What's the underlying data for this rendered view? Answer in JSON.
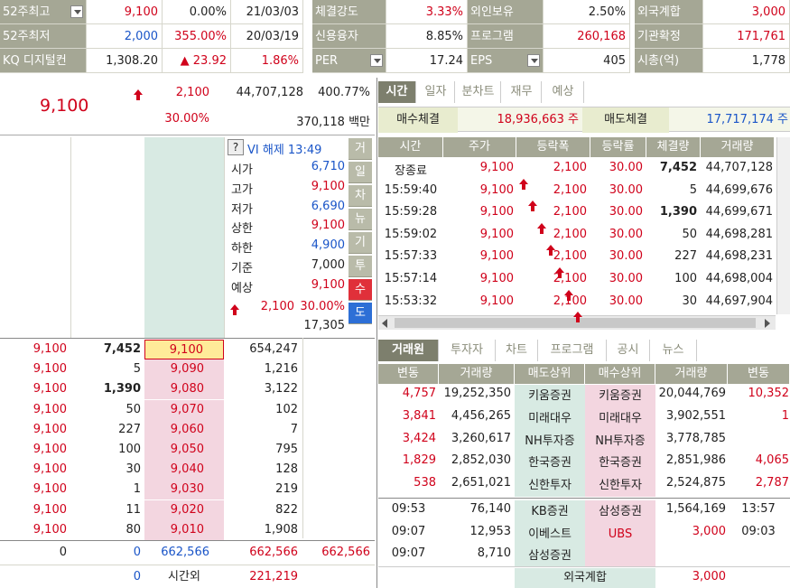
{
  "top": {
    "r1": {
      "l1": "52주최고",
      "v1": "9,100",
      "p1": "0.00%",
      "d1": "21/03/03",
      "l2": "체결강도",
      "v2": "3.33%",
      "l3": "외인보유",
      "v3": "2.50%",
      "l4": "외국계합",
      "v4": "3,000"
    },
    "r2": {
      "l1": "52주최저",
      "v1": "2,000",
      "p1": "355.00%",
      "d1": "20/03/19",
      "l2": "신용융자",
      "v2": "8.85%",
      "l3": "프로그램",
      "v3": "260,168",
      "l4": "기관확정",
      "v4": "171,761"
    },
    "r3": {
      "l1": "KQ 디지털컨",
      "v1": "1,308.20",
      "p1": "▲ 23.92",
      "d1": "1.86%",
      "l2": "PER",
      "v2": "17.24",
      "l3": "EPS",
      "v3": "405",
      "l4": "시총(억)",
      "v4": "1,778"
    }
  },
  "price": {
    "current": "9,100",
    "change": "2,100",
    "volume": "44,707,128",
    "vol_rate": "400.77%",
    "change_rate": "30.00%",
    "amount": "370,118 백만"
  },
  "vi": {
    "q": "?",
    "text": "VI 해제 13:49"
  },
  "info": [
    {
      "label": "시가",
      "value": "6,710",
      "color": "blue"
    },
    {
      "label": "고가",
      "value": "9,100",
      "color": "red"
    },
    {
      "label": "저가",
      "value": "6,690",
      "color": "blue"
    },
    {
      "label": "상한",
      "value": "9,100",
      "color": "red"
    },
    {
      "label": "하한",
      "value": "4,900",
      "color": "blue"
    },
    {
      "label": "기준",
      "value": "7,000",
      "color": "black"
    },
    {
      "label": "예상",
      "value": "9,100",
      "color": "red"
    }
  ],
  "expected": {
    "change": "2,100",
    "rate": "30.00%",
    "qty": "17,305"
  },
  "side_buttons": [
    "거",
    "일",
    "차",
    "뉴",
    "기",
    "투",
    "수",
    "도"
  ],
  "bids": [
    {
      "price_l": "9,100",
      "qty": "7,452",
      "bid": "9,100",
      "bidqty": "654,247"
    },
    {
      "price_l": "9,100",
      "qty": "5",
      "bid": "9,090",
      "bidqty": "1,216"
    },
    {
      "price_l": "9,100",
      "qty": "1,390",
      "bid": "9,080",
      "bidqty": "3,122"
    },
    {
      "price_l": "9,100",
      "qty": "50",
      "bid": "9,070",
      "bidqty": "102"
    },
    {
      "price_l": "9,100",
      "qty": "227",
      "bid": "9,060",
      "bidqty": "7"
    },
    {
      "price_l": "9,100",
      "qty": "100",
      "bid": "9,050",
      "bidqty": "795"
    },
    {
      "price_l": "9,100",
      "qty": "30",
      "bid": "9,040",
      "bidqty": "128"
    },
    {
      "price_l": "9,100",
      "qty": "1",
      "bid": "9,030",
      "bidqty": "219"
    },
    {
      "price_l": "9,100",
      "qty": "11",
      "bid": "9,020",
      "bidqty": "822"
    },
    {
      "price_l": "9,100",
      "qty": "80",
      "bid": "9,010",
      "bidqty": "1,908"
    }
  ],
  "totals": {
    "a": "0",
    "b": "0",
    "c": "662,566",
    "d": "662,566",
    "e": "662,566"
  },
  "after": {
    "b": "0",
    "label": "시간외",
    "value": "221,219"
  },
  "tabs1": [
    "시간",
    "일자",
    "분차트",
    "재무",
    "예상"
  ],
  "trade": {
    "buy_label": "매수체결",
    "buy_val": "18,936,663 주",
    "sell_label": "매도체결",
    "sell_val": "17,717,174 주"
  },
  "ticks_head": [
    "시간",
    "주가",
    "등락폭",
    "등락률",
    "체결량",
    "거래량"
  ],
  "ticks": [
    {
      "t": "장종료",
      "p": "9,100",
      "c": "2,100",
      "r": "30.00",
      "q": "7,452",
      "v": "44,707,128",
      "bold": true
    },
    {
      "t": "15:59:40",
      "p": "9,100",
      "c": "2,100",
      "r": "30.00",
      "q": "5",
      "v": "44,699,676",
      "bold": false
    },
    {
      "t": "15:59:28",
      "p": "9,100",
      "c": "2,100",
      "r": "30.00",
      "q": "1,390",
      "v": "44,699,671",
      "bold": true
    },
    {
      "t": "15:59:02",
      "p": "9,100",
      "c": "2,100",
      "r": "30.00",
      "q": "50",
      "v": "44,698,281",
      "bold": false
    },
    {
      "t": "15:57:33",
      "p": "9,100",
      "c": "2,100",
      "r": "30.00",
      "q": "227",
      "v": "44,698,231",
      "bold": false
    },
    {
      "t": "15:57:14",
      "p": "9,100",
      "c": "2,100",
      "r": "30.00",
      "q": "100",
      "v": "44,698,004",
      "bold": false
    },
    {
      "t": "15:53:32",
      "p": "9,100",
      "c": "2,100",
      "r": "30.00",
      "q": "30",
      "v": "44,697,904",
      "bold": false
    }
  ],
  "tabs2": [
    "거래원",
    "투자자",
    "차트",
    "프로그램",
    "공시",
    "뉴스"
  ],
  "broker_head": [
    "변동",
    "거래량",
    "매도상위",
    "매수상위",
    "거래량",
    "변동"
  ],
  "brokers": [
    {
      "c1": "4,757",
      "v1": "19,252,350",
      "s": "키움증권",
      "b": "키움증권",
      "v2": "20,044,769",
      "c2": "10,352"
    },
    {
      "c1": "3,841",
      "v1": "4,456,265",
      "s": "미래대우",
      "b": "미래대우",
      "v2": "3,902,551",
      "c2": "1"
    },
    {
      "c1": "3,424",
      "v1": "3,260,617",
      "s": "NH투자증",
      "b": "NH투자증",
      "v2": "3,778,785",
      "c2": ""
    },
    {
      "c1": "1,829",
      "v1": "2,852,030",
      "s": "한국증권",
      "b": "한국증권",
      "v2": "2,851,986",
      "c2": "4,065"
    },
    {
      "c1": "538",
      "v1": "2,651,021",
      "s": "신한투자",
      "b": "신한투자",
      "v2": "2,524,875",
      "c2": "2,787"
    }
  ],
  "foreign": [
    {
      "t1": "09:53",
      "v1": "76,140",
      "s": "KB증권",
      "b": "삼성증권",
      "v2": "1,564,169",
      "t2": "13:57"
    },
    {
      "t1": "09:07",
      "v1": "12,953",
      "s": "이베스트",
      "b": "UBS",
      "v2": "3,000",
      "t2": "09:03"
    },
    {
      "t1": "09:07",
      "v1": "8,710",
      "s": "삼성증권",
      "b": "",
      "v2": "",
      "t2": ""
    }
  ],
  "foreign_total": {
    "label": "외국계합",
    "value": "3,000"
  }
}
